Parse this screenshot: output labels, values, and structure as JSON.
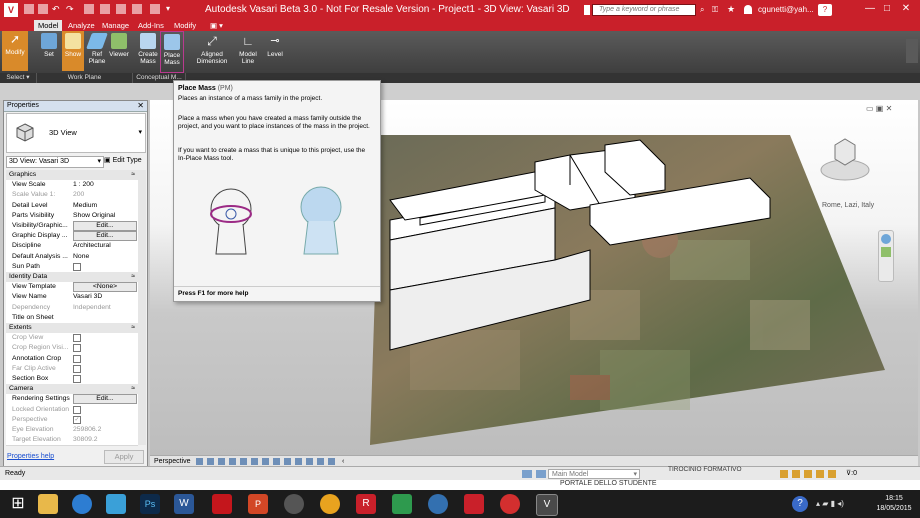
{
  "titlebar": {
    "title": "Autodesk Vasari Beta 3.0 - Not For Resale Version -     Project1 - 3D View: Vasari 3D",
    "search_placeholder": "Type a keyword or phrase",
    "user": "cgunetti@yah...",
    "minimize": "—",
    "maximize": "□",
    "close": "✕"
  },
  "ribbon": {
    "tabs": [
      "Model",
      "Analyze",
      "Manage",
      "Add-Ins",
      "Modify"
    ],
    "buttons": {
      "modify": "Modify",
      "set": "Set",
      "show": "Show",
      "ref_plane": "Ref Plane",
      "viewer": "Viewer",
      "create_mass": "Create Mass",
      "place_mass": "Place Mass",
      "aligned_dimension": "Aligned Dimension",
      "model_line": "Model Line",
      "level": "Level"
    },
    "groups": {
      "select": "Select",
      "work_plane": "Work Plane",
      "conceptual_mass": "Conceptual M..."
    }
  },
  "tooltip": {
    "title": "Place Mass",
    "shortcut": "(PM)",
    "summary": "Places an instance of a mass family in the project.",
    "para1": "Place a mass when you have created a mass family outside the project, and you want to place instances of the mass in the project.",
    "para2": "If you want to create a mass that is unique to this project, use the In-Place Mass tool.",
    "footer": "Press F1 for more help"
  },
  "properties": {
    "header": "Properties",
    "type_name": "3D View",
    "selector": "3D View: Vasari 3D",
    "edit_type": "Edit Type",
    "rows": [
      {
        "kind": "cat",
        "label": "Graphics",
        "value": ""
      },
      {
        "kind": "row",
        "label": "View Scale",
        "value": "1 : 200"
      },
      {
        "kind": "grey",
        "label": "Scale Value    1:",
        "value": "200"
      },
      {
        "kind": "row",
        "label": "Detail Level",
        "value": "Medium"
      },
      {
        "kind": "row",
        "label": "Parts Visibility",
        "value": "Show Original"
      },
      {
        "kind": "btn",
        "label": "Visibility/Graphic...",
        "value": "Edit..."
      },
      {
        "kind": "btn",
        "label": "Graphic Display ...",
        "value": "Edit..."
      },
      {
        "kind": "row",
        "label": "Discipline",
        "value": "Architectural"
      },
      {
        "kind": "row",
        "label": "Default Analysis ...",
        "value": "None"
      },
      {
        "kind": "chk",
        "label": "Sun Path",
        "value": ""
      },
      {
        "kind": "cat",
        "label": "Identity Data",
        "value": ""
      },
      {
        "kind": "btn",
        "label": "View Template",
        "value": "<None>"
      },
      {
        "kind": "row",
        "label": "View Name",
        "value": "Vasari 3D"
      },
      {
        "kind": "grey",
        "label": "Dependency",
        "value": "Independent"
      },
      {
        "kind": "row",
        "label": "Title on Sheet",
        "value": ""
      },
      {
        "kind": "cat",
        "label": "Extents",
        "value": ""
      },
      {
        "kind": "greychk",
        "label": "Crop View",
        "value": ""
      },
      {
        "kind": "greychk",
        "label": "Crop Region Visi...",
        "value": ""
      },
      {
        "kind": "chk",
        "label": "Annotation Crop",
        "value": ""
      },
      {
        "kind": "greychk",
        "label": "Far Clip Active",
        "value": ""
      },
      {
        "kind": "chk",
        "label": "Section Box",
        "value": ""
      },
      {
        "kind": "cat",
        "label": "Camera",
        "value": ""
      },
      {
        "kind": "btn",
        "label": "Rendering Settings",
        "value": "Edit..."
      },
      {
        "kind": "greychk",
        "label": "Locked Orientation",
        "value": ""
      },
      {
        "kind": "greychk",
        "label": "Perspective",
        "value": "✓"
      },
      {
        "kind": "grey",
        "label": "Eye Elevation",
        "value": "259806.2"
      },
      {
        "kind": "grey",
        "label": "Target Elevation",
        "value": "30809.2"
      }
    ],
    "help_link": "Properties help",
    "apply": "Apply"
  },
  "viewport": {
    "location_label": "Rome, Lazi, Italy",
    "view_mode": "Perspective"
  },
  "status": {
    "ready": "Ready",
    "model_select": "Main Model",
    "filter_count": ":0",
    "bg_text1": "PORTALE DELLO STUDENTE",
    "bg_text2": "TIROCINIO FORMATIVO"
  },
  "taskbar": {
    "time": "18:15",
    "date": "18/05/2015"
  }
}
